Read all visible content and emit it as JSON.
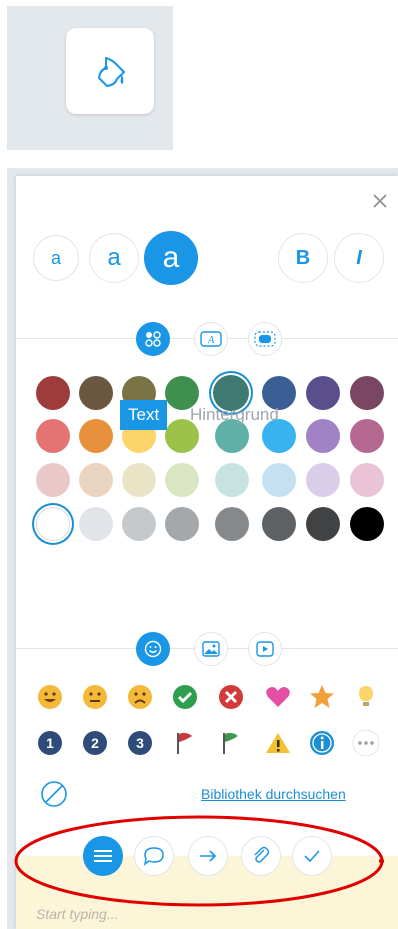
{
  "colors": {
    "accent": "#1a96e6",
    "swatches_row1": [
      "#9e3b3b",
      "#6b5640",
      "#7a7345",
      "#3f8f4f",
      "#3e7a72",
      "#3a5f95",
      "#5a4e8c",
      "#7a4662"
    ],
    "swatches_row2": [
      "#e57373",
      "#e8913c",
      "#fcd46a",
      "#9cc24a",
      "#5fb0a8",
      "#38b3f0",
      "#a182c6",
      "#b56990"
    ],
    "swatches_row3": [
      "#eac8c8",
      "#ead4c2",
      "#eae4c6",
      "#d8e6c4",
      "#c8e4e2",
      "#c6e0f3",
      "#dacde9",
      "#ebc3d6"
    ],
    "swatches_row4": [
      "#ffffff",
      "#e1e5ea",
      "#c6c9cc",
      "#a5a8ab",
      "#86898c",
      "#5f6265",
      "#404244",
      "#000000"
    ]
  },
  "font_size_buttons": [
    "a",
    "a",
    "a"
  ],
  "style_buttons": {
    "bold": "B",
    "italic": "I"
  },
  "tabs": {
    "text": "Text",
    "background": "Hintergrund"
  },
  "library_link": "Bibliothek durchsuchen",
  "input": {
    "placeholder": "Start typing..."
  },
  "icons": {
    "paint": "paint-bucket-icon",
    "close": "close-icon",
    "swatch_mode": "swatch-grid-icon",
    "text_mode": "text-box-icon",
    "bg_mode": "highlight-icon"
  }
}
